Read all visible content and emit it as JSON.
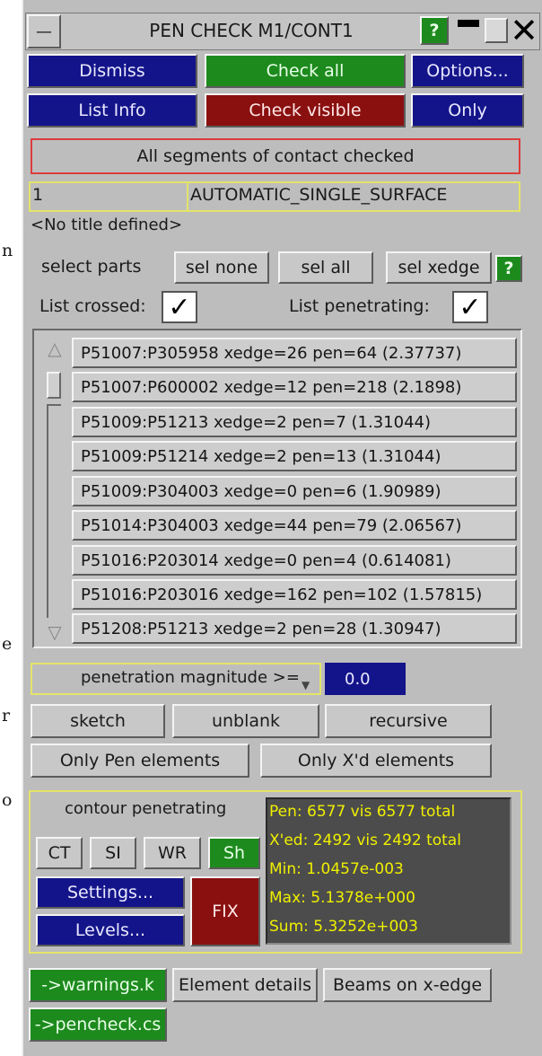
{
  "window": {
    "title": "PEN CHECK M1/CONT1",
    "help": "?"
  },
  "toolbar": {
    "dismiss": "Dismiss",
    "check_all": "Check all",
    "options": "Options...",
    "list_info": "List Info",
    "check_visible": "Check visible",
    "only": "Only"
  },
  "status": "All segments of contact checked",
  "contact": {
    "id": "1",
    "type": "AUTOMATIC_SINGLE_SURFACE",
    "title": "<No title defined>"
  },
  "parts": {
    "label": "select parts",
    "sel_none": "sel none",
    "sel_all": "sel all",
    "sel_xedge": "sel xedge",
    "help": "?"
  },
  "options": {
    "list_crossed": "List crossed:",
    "list_penetrating": "List penetrating:",
    "list_crossed_checked": true,
    "list_penetrating_checked": true
  },
  "results": [
    "P51007:P305958 xedge=26 pen=64 (2.37737)",
    "P51007:P600002 xedge=12 pen=218 (2.1898)",
    "P51009:P51213 xedge=2 pen=7 (1.31044)",
    "P51009:P51214 xedge=2 pen=13 (1.31044)",
    "P51009:P304003 xedge=0 pen=6 (1.90989)",
    "P51014:P304003 xedge=44 pen=79 (2.06567)",
    "P51016:P203014 xedge=0 pen=4 (0.614081)",
    "P51016:P203016 xedge=162 pen=102 (1.57815)",
    "P51208:P51213 xedge=2 pen=28 (1.30947)"
  ],
  "filter": {
    "label": "penetration magnitude >=",
    "value": "0.0"
  },
  "display": {
    "sketch": "sketch",
    "unblank": "unblank",
    "recursive": "recursive",
    "only_pen": "Only Pen elements",
    "only_xd": "Only X'd elements"
  },
  "contour": {
    "label": "contour penetrating",
    "ct": "CT",
    "si": "SI",
    "wr": "WR",
    "sh": "Sh",
    "settings": "Settings...",
    "levels": "Levels...",
    "fix": "FIX"
  },
  "stats": {
    "pen": "Pen: 6577 vis 6577 total",
    "xed": "X'ed: 2492 vis 2492 total",
    "min": "Min:  1.0457e-003",
    "max": "Max:  5.1378e+000",
    "sum": "Sum:  5.3252e+003"
  },
  "footer": {
    "warnings": "->warnings.k",
    "element_details": "Element details",
    "beams": "Beams on x-edge",
    "pencheck": "->pencheck.cs"
  },
  "side_chars": [
    "n",
    "e",
    "r",
    "o"
  ],
  "colors": {
    "panel": "#bdbdbd",
    "blue_button": "#14148a",
    "green_button": "#1d8a1d",
    "red_button": "#8a1010",
    "stats_bg": "#4c4c4c",
    "stats_text": "#f0f000"
  }
}
